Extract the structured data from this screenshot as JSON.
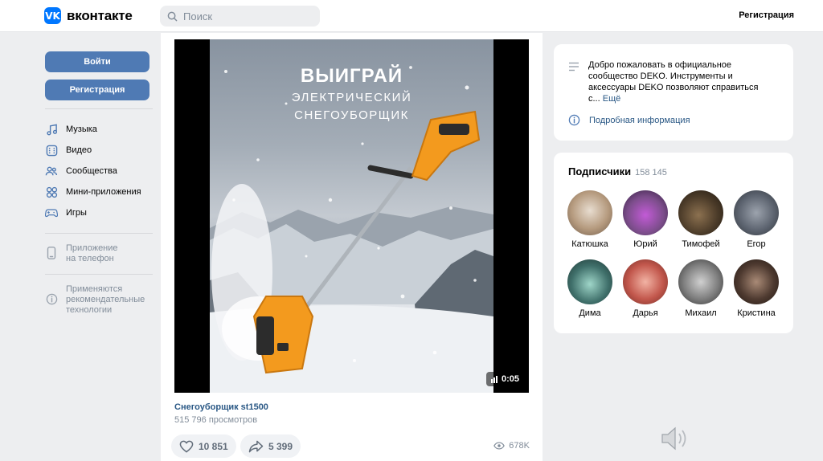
{
  "header": {
    "logo_text": "вконтакте",
    "logo_mark": "VK",
    "search_placeholder": "Поиск",
    "register_label": "Регистрация"
  },
  "sidebar": {
    "login_button": "Войти",
    "register_button": "Регистрация",
    "nav_items": [
      {
        "label": "Музыка",
        "icon": "music-icon"
      },
      {
        "label": "Видео",
        "icon": "video-icon"
      },
      {
        "label": "Сообщества",
        "icon": "communities-icon"
      },
      {
        "label": "Мини-приложения",
        "icon": "mini-apps-icon"
      },
      {
        "label": "Игры",
        "icon": "games-icon"
      }
    ],
    "app_link": "Приложение\nна телефон",
    "recommend_link": "Применяются\nрекомендательные\nтехнологии"
  },
  "video": {
    "poster_title": "ВЫИГРАЙ",
    "poster_subtitle_1": "ЭЛЕКТРИЧЕСКИЙ",
    "poster_subtitle_2": "СНЕГОУБОРЩИК",
    "duration": "0:05",
    "title": "Снегоуборщик st1500",
    "views": "515 796 просмотров",
    "likes": "10 851",
    "shares": "5 399",
    "views_total": "678K"
  },
  "about": {
    "text": "Добро пожаловать в официальное сообщество DEKO. Инструменты и аксессуары DEKO позволяют справиться с...",
    "more": "Ещё",
    "details_link": "Подробная информация"
  },
  "subscribers": {
    "title": "Подписчики",
    "count": "158 145",
    "people": [
      {
        "name": "Катюшка",
        "color": "#b59a7e"
      },
      {
        "name": "Юрий",
        "color": "#7b4d8a"
      },
      {
        "name": "Тимофей",
        "color": "#4a3a28"
      },
      {
        "name": "Егор",
        "color": "#5d6470"
      },
      {
        "name": "Дима",
        "color": "#3f6f6a"
      },
      {
        "name": "Дарья",
        "color": "#c2574c"
      },
      {
        "name": "Михаил",
        "color": "#7d7d7d"
      },
      {
        "name": "Кристина",
        "color": "#4e3a30"
      }
    ]
  },
  "colors": {
    "accent": "#4f7ab4",
    "link": "#2a5885",
    "muted": "#818c99",
    "background": "#edeef0"
  }
}
